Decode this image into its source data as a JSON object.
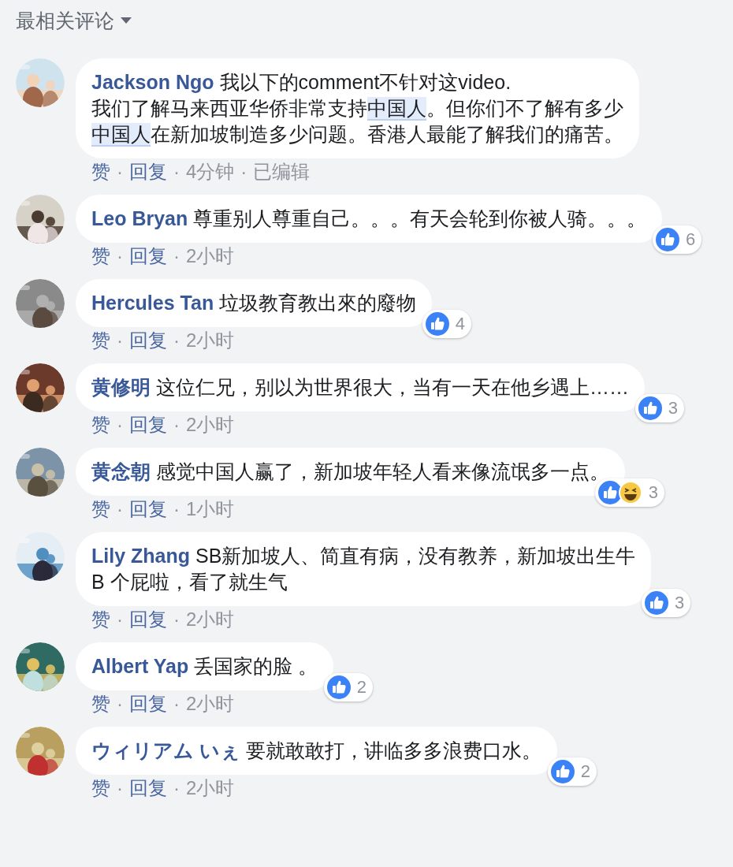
{
  "sort_menu": {
    "label": "最相关评论"
  },
  "action_separator": "·",
  "comments": [
    {
      "author": "Jackson Ngo",
      "segments": [
        {
          "text": "我以下的comment不针对这video.\n我们了解马来西亚华侨非常支持",
          "highlighted": false
        },
        {
          "text": "中国人",
          "highlighted": true
        },
        {
          "text": "。但你们不了解有多少\n",
          "highlighted": false
        },
        {
          "text": "中国人",
          "highlighted": true
        },
        {
          "text": "在新加坡制造多少问题。香港人最能了解我们的痛苦。",
          "highlighted": false
        }
      ],
      "actions": [
        {
          "text": "赞",
          "kind": "link"
        },
        {
          "text": "回复",
          "kind": "link"
        },
        {
          "text": "4分钟",
          "kind": "meta"
        },
        {
          "text": "已编辑",
          "kind": "meta"
        }
      ]
    },
    {
      "author": "Leo Bryan",
      "segments": [
        {
          "text": "尊重别人尊重自己。。。有天会轮到你被人骑。。。",
          "highlighted": false
        }
      ],
      "reactions": {
        "haha": false,
        "count": "6"
      },
      "actions": [
        {
          "text": "赞",
          "kind": "link"
        },
        {
          "text": "回复",
          "kind": "link"
        },
        {
          "text": "2小时",
          "kind": "meta"
        }
      ]
    },
    {
      "author": "Hercules Tan",
      "segments": [
        {
          "text": "垃圾教育教出來的廢物",
          "highlighted": false
        }
      ],
      "reactions": {
        "haha": false,
        "count": "4"
      },
      "actions": [
        {
          "text": "赞",
          "kind": "link"
        },
        {
          "text": "回复",
          "kind": "link"
        },
        {
          "text": "2小时",
          "kind": "meta"
        }
      ]
    },
    {
      "author": "黄修明",
      "segments": [
        {
          "text": "这位仁兄，别以为世界很大，当有一天在他乡遇上……",
          "highlighted": false
        }
      ],
      "reactions": {
        "haha": false,
        "count": "3"
      },
      "actions": [
        {
          "text": "赞",
          "kind": "link"
        },
        {
          "text": "回复",
          "kind": "link"
        },
        {
          "text": "2小时",
          "kind": "meta"
        }
      ]
    },
    {
      "author": "黄念朝",
      "segments": [
        {
          "text": "感觉中国人赢了，新加坡年轻人看来像流氓多一点。",
          "highlighted": false
        }
      ],
      "reactions": {
        "haha": true,
        "count": "3"
      },
      "actions": [
        {
          "text": "赞",
          "kind": "link"
        },
        {
          "text": "回复",
          "kind": "link"
        },
        {
          "text": "1小时",
          "kind": "meta"
        }
      ]
    },
    {
      "author": "Lily Zhang",
      "segments": [
        {
          "text": "SB新加坡人、简直有病，没有教养，新加坡出生牛\nB 个屁啦，看了就生气",
          "highlighted": false
        }
      ],
      "reactions": {
        "haha": false,
        "count": "3"
      },
      "actions": [
        {
          "text": "赞",
          "kind": "link"
        },
        {
          "text": "回复",
          "kind": "link"
        },
        {
          "text": "2小时",
          "kind": "meta"
        }
      ]
    },
    {
      "author": "Albert Yap",
      "segments": [
        {
          "text": "丢国家的脸 。",
          "highlighted": false
        }
      ],
      "reactions": {
        "haha": false,
        "count": "2"
      },
      "actions": [
        {
          "text": "赞",
          "kind": "link"
        },
        {
          "text": "回复",
          "kind": "link"
        },
        {
          "text": "2小时",
          "kind": "meta"
        }
      ]
    },
    {
      "author": "ウィリアム いぇ",
      "segments": [
        {
          "text": "要就敢敢打，讲临多多浪费口水。",
          "highlighted": false
        }
      ],
      "reactions": {
        "haha": false,
        "count": "2"
      },
      "actions": [
        {
          "text": "赞",
          "kind": "link"
        },
        {
          "text": "回复",
          "kind": "link"
        },
        {
          "text": "2小时",
          "kind": "meta"
        }
      ]
    }
  ]
}
